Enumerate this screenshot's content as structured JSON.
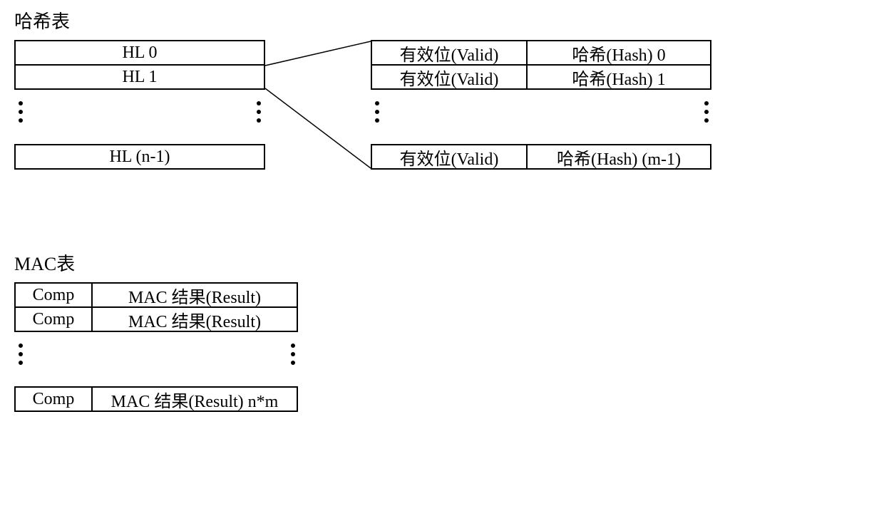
{
  "titles": {
    "hashTable": "哈希表",
    "macTable": "MAC表"
  },
  "hashTable": {
    "rows": [
      {
        "label": "HL 0"
      },
      {
        "label": "HL 1"
      },
      {
        "label": "HL (n-1)"
      }
    ]
  },
  "detailTable": {
    "rows": [
      {
        "valid": "有效位(Valid)",
        "hash": "哈希(Hash) 0"
      },
      {
        "valid": "有效位(Valid)",
        "hash": "哈希(Hash) 1"
      },
      {
        "valid": "有效位(Valid)",
        "hash": "哈希(Hash) (m-1)"
      }
    ]
  },
  "macTable": {
    "rows": [
      {
        "comp": "Comp",
        "result": "MAC 结果(Result)"
      },
      {
        "comp": "Comp",
        "result": "MAC 结果(Result)"
      },
      {
        "comp": "Comp",
        "result": "MAC 结果(Result) n*m"
      }
    ]
  },
  "chart_data": {
    "type": "table",
    "title": "Hash Table and MAC Table Structure Diagram",
    "tables": [
      {
        "name": "哈希表 (Hash Table)",
        "entries": [
          "HL 0",
          "HL 1",
          "...",
          "HL (n-1)"
        ],
        "entry_structure": {
          "fields": [
            "有效位(Valid)",
            "哈希(Hash)"
          ],
          "count": "m",
          "examples": [
            "哈希(Hash) 0",
            "哈希(Hash) 1",
            "...",
            "哈希(Hash) (m-1)"
          ]
        }
      },
      {
        "name": "MAC表 (MAC Table)",
        "fields": [
          "Comp",
          "MAC 结果(Result)"
        ],
        "count": "n*m"
      }
    ]
  }
}
